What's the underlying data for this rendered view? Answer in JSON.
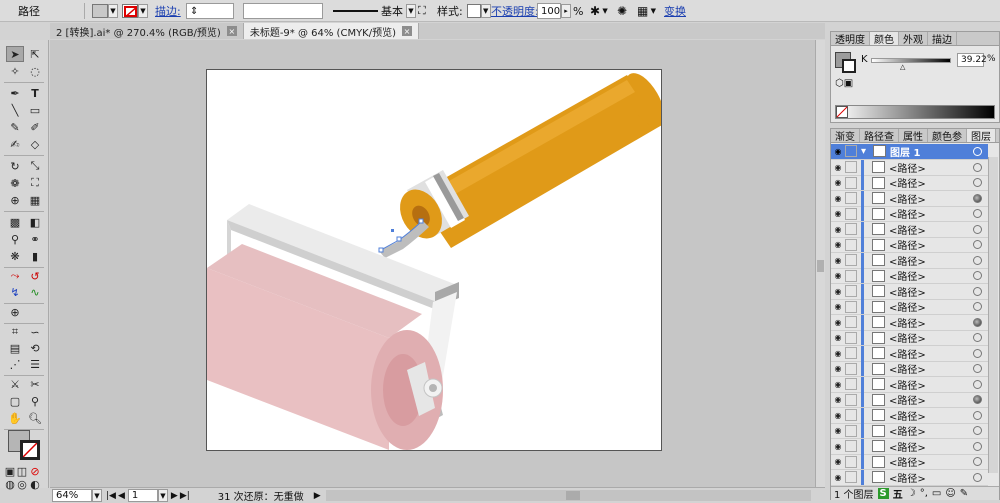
{
  "controlbar": {
    "selection_type": "路径",
    "stroke_label": "描边:",
    "stroke_style_label": "基本",
    "style_label": "样式:",
    "opacity_label": "不透明度:",
    "opacity_value": "100",
    "opacity_unit": "%",
    "transform_label": "变换"
  },
  "tabs": [
    {
      "label": "2 [转换].ai* @ 270.4% (RGB/预览)"
    },
    {
      "label": "未标题-9* @ 64% (CMYK/预览)"
    }
  ],
  "status": {
    "zoom": "64%",
    "page": "1",
    "message": "31 次还原：无重做"
  },
  "color_panel": {
    "tabs": [
      "透明度",
      "颜色",
      "外观",
      "描边"
    ],
    "channel_label": "K",
    "channel_value": "39.22",
    "channel_unit": "%"
  },
  "layers_panel": {
    "tabs": [
      "渐变",
      "路径查",
      "属性",
      "颜色参",
      "图层"
    ],
    "layer_name": "图层 1",
    "item_label": "<路径>",
    "footer_text": "1 个图层",
    "ime_text": "五"
  },
  "colors": {
    "handle_orange": "#e09a18",
    "roller_pink": "#e9c0c2",
    "frame_gray": "#e8e8e8",
    "selection_blue": "#4f7fd9"
  }
}
